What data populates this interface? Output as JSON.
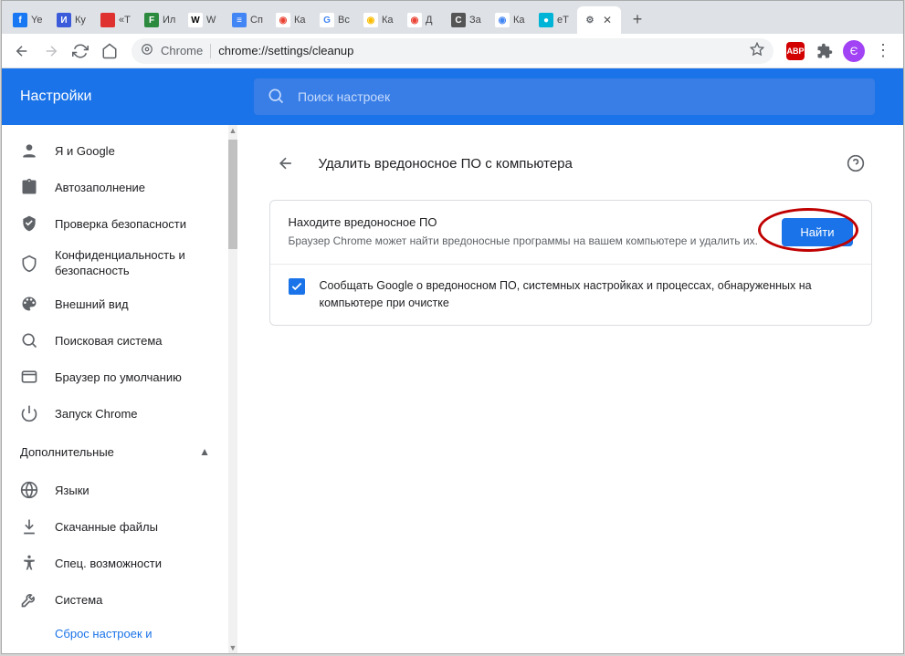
{
  "window_controls": {
    "min": "─",
    "max": "▣",
    "close": "✕"
  },
  "tabs": [
    {
      "label": "Ye",
      "favicon_bg": "#1877f2",
      "favicon_txt": "f",
      "favicon_color": "#fff"
    },
    {
      "label": "Ку",
      "favicon_bg": "#3b5bdb",
      "favicon_txt": "И",
      "favicon_color": "#fff"
    },
    {
      "label": "«Т",
      "favicon_bg": "#e03131",
      "favicon_txt": "",
      "favicon_color": "#fff"
    },
    {
      "label": "Ил",
      "favicon_bg": "#2b8a3e",
      "favicon_txt": "F",
      "favicon_color": "#fff"
    },
    {
      "label": "W",
      "favicon_bg": "#ffffff",
      "favicon_txt": "W",
      "favicon_color": "#000"
    },
    {
      "label": "Сп",
      "favicon_bg": "#4285f4",
      "favicon_txt": "≡",
      "favicon_color": "#fff"
    },
    {
      "label": "Ка",
      "favicon_bg": "#ffffff",
      "favicon_txt": "◉",
      "favicon_color": "#ea4335"
    },
    {
      "label": "Вс",
      "favicon_bg": "#ffffff",
      "favicon_txt": "G",
      "favicon_color": "#4285f4"
    },
    {
      "label": "Ка",
      "favicon_bg": "#ffffff",
      "favicon_txt": "◉",
      "favicon_color": "#fbbc04"
    },
    {
      "label": "Д",
      "favicon_bg": "#ffffff",
      "favicon_txt": "◉",
      "favicon_color": "#ea4335"
    },
    {
      "label": "За",
      "favicon_bg": "#555555",
      "favicon_txt": "C",
      "favicon_color": "#fff"
    },
    {
      "label": "Ка",
      "favicon_bg": "#ffffff",
      "favicon_txt": "◉",
      "favicon_color": "#4285f4"
    },
    {
      "label": "eT",
      "favicon_bg": "#00b4d8",
      "favicon_txt": "●",
      "favicon_color": "#fff"
    }
  ],
  "active_tab": {
    "icon": "⚙",
    "close": "✕"
  },
  "newtab": "+",
  "toolbar": {
    "chrome_label": "Chrome",
    "url": "chrome://settings/cleanup",
    "abp": "ABP",
    "profile_initial": "Є",
    "menu": "⋮"
  },
  "header": {
    "title": "Настройки",
    "search_placeholder": "Поиск настроек"
  },
  "sidebar": {
    "items": [
      {
        "label": "Я и Google",
        "icon": "person"
      },
      {
        "label": "Автозаполнение",
        "icon": "clipboard"
      },
      {
        "label": "Проверка безопасности",
        "icon": "shield-check"
      },
      {
        "label": "Конфиденциальность и безопасность",
        "icon": "shield",
        "two_line": true
      },
      {
        "label": "Внешний вид",
        "icon": "palette"
      },
      {
        "label": "Поисковая система",
        "icon": "search"
      },
      {
        "label": "Браузер по умолчанию",
        "icon": "browser"
      },
      {
        "label": "Запуск Chrome",
        "icon": "power"
      }
    ],
    "advanced_label": "Дополнительные",
    "adv_items": [
      {
        "label": "Языки",
        "icon": "globe"
      },
      {
        "label": "Скачанные файлы",
        "icon": "download"
      },
      {
        "label": "Спец. возможности",
        "icon": "accessibility"
      },
      {
        "label": "Система",
        "icon": "wrench"
      }
    ],
    "reset_label": "Сброс настроек и"
  },
  "main": {
    "page_title": "Удалить вредоносное ПО с компьютера",
    "find_heading": "Находите вредоносное ПО",
    "find_desc": "Браузер Chrome может найти вредоносные программы на вашем компьютере и удалить их.",
    "find_button": "Найти",
    "report_text": "Сообщать Google о вредоносном ПО, системных настройках и процессах, обнаруженных на компьютере при очистке"
  }
}
